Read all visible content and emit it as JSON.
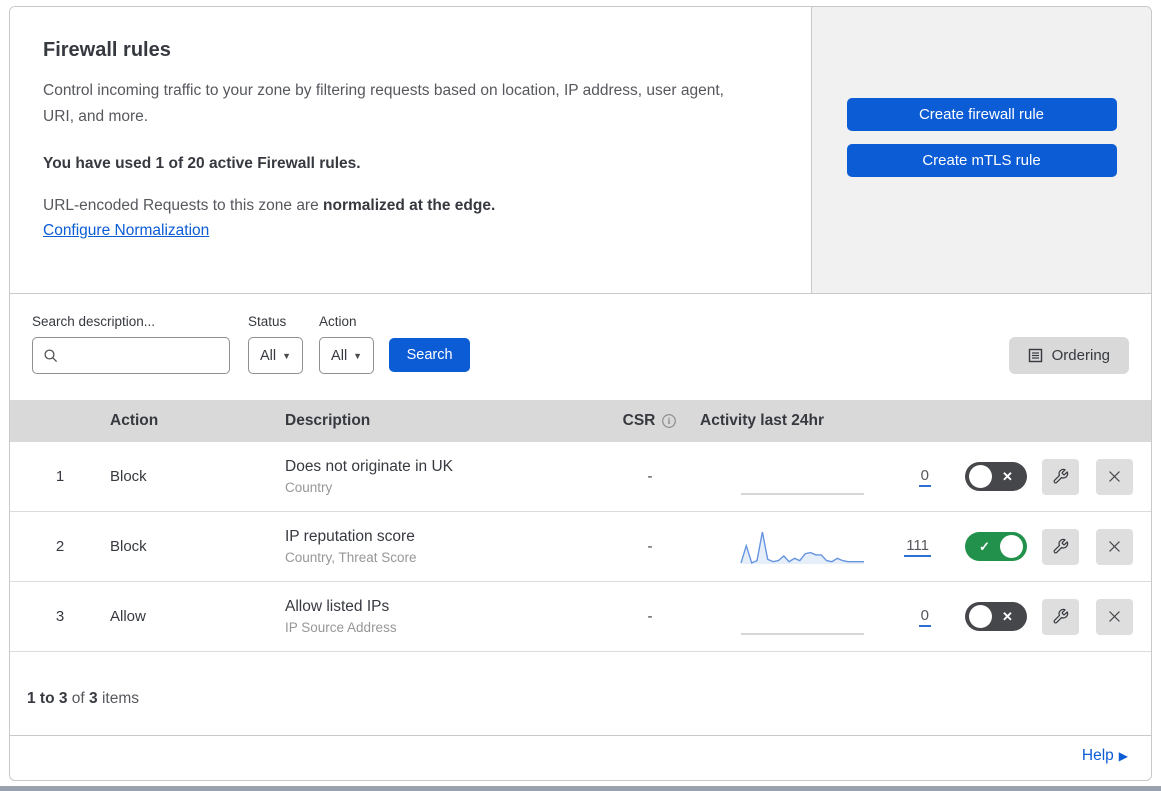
{
  "header": {
    "title": "Firewall rules",
    "description": "Control incoming traffic to your zone by filtering requests based on location, IP address, user agent, URI, and more.",
    "usage": "You have used 1 of 20 active Firewall rules.",
    "normalization_text": "URL-encoded Requests to this zone are ",
    "normalization_bold": "normalized at the edge.",
    "configure_link": "Configure Normalization",
    "create_firewall_button": "Create firewall rule",
    "create_mtls_button": "Create mTLS rule"
  },
  "filters": {
    "search_label": "Search description...",
    "status_label": "Status",
    "status_value": "All",
    "action_label": "Action",
    "action_value": "All",
    "search_button": "Search",
    "ordering_button": "Ordering"
  },
  "table": {
    "headers": {
      "action": "Action",
      "description": "Description",
      "csr": "CSR",
      "activity": "Activity last 24hr"
    }
  },
  "rules": [
    {
      "index": "1",
      "action": "Block",
      "description": "Does not originate in UK",
      "fields": "Country",
      "csr": "-",
      "activity_count": "0",
      "enabled": false,
      "spark": [
        0,
        0,
        0,
        0,
        0,
        0,
        0,
        0,
        0,
        0,
        0,
        0,
        0,
        0,
        0,
        0,
        0,
        0,
        0,
        0,
        0,
        0,
        0,
        0
      ]
    },
    {
      "index": "2",
      "action": "Block",
      "description": "IP reputation score",
      "fields": "Country, Threat Score",
      "csr": "-",
      "activity_count": "111",
      "enabled": true,
      "spark": [
        1,
        16,
        1,
        3,
        28,
        4,
        2,
        3,
        7,
        2,
        5,
        3,
        9,
        10,
        8,
        8,
        3,
        2,
        5,
        3,
        2,
        2,
        2,
        2
      ]
    },
    {
      "index": "3",
      "action": "Allow",
      "description": "Allow listed IPs",
      "fields": "IP Source Address",
      "csr": "-",
      "activity_count": "0",
      "enabled": false,
      "spark": [
        0,
        0,
        0,
        0,
        0,
        0,
        0,
        0,
        0,
        0,
        0,
        0,
        0,
        0,
        0,
        0,
        0,
        0,
        0,
        0,
        0,
        0,
        0,
        0
      ]
    }
  ],
  "footer": {
    "range": "1 to 3",
    "of": "of",
    "total": "3",
    "items": "items",
    "help": "Help"
  },
  "colors": {
    "accent_blue": "#0b5cd5",
    "toggle_on_green": "#21914b",
    "toggle_off_gray": "#46474b",
    "spark_line_blue": "#6595e0",
    "header_band_gray": "#d9d9d9"
  }
}
